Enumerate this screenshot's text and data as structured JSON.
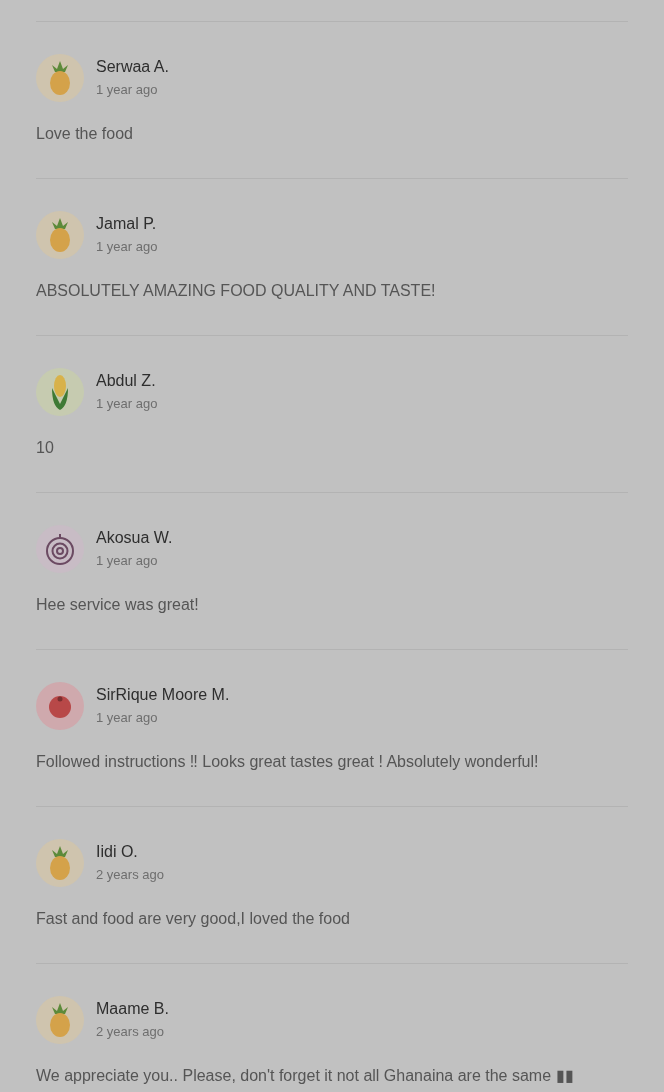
{
  "reviews": [
    {
      "avatar": {
        "kind": "pineapple"
      },
      "name": "Serwaa A.",
      "time": "1 year ago",
      "text": "Love the food"
    },
    {
      "avatar": {
        "kind": "pineapple"
      },
      "name": "Jamal P.",
      "time": "1 year ago",
      "text": "ABSOLUTELY AMAZING FOOD QUALITY AND TASTE!"
    },
    {
      "avatar": {
        "kind": "corn"
      },
      "name": "Abdul Z.",
      "time": "1 year ago",
      "text": "10"
    },
    {
      "avatar": {
        "kind": "onion"
      },
      "name": "Akosua W.",
      "time": "1 year ago",
      "text": "Hee service was great!"
    },
    {
      "avatar": {
        "kind": "tomato"
      },
      "name": "SirRique Moore M.",
      "time": "1 year ago",
      "text": "Followed instructions ‼ Looks great tastes great ! Absolutely wonderful!"
    },
    {
      "avatar": {
        "kind": "pineapple"
      },
      "name": "Iidi O.",
      "time": "2 years ago",
      "text": "Fast and food are very good,I loved the food"
    },
    {
      "avatar": {
        "kind": "pineapple"
      },
      "name": "Maame B.",
      "time": "2 years ago",
      "text": "We appreciate you.. Please, don't forget it not all Ghanaina are the same ▮▮"
    }
  ]
}
